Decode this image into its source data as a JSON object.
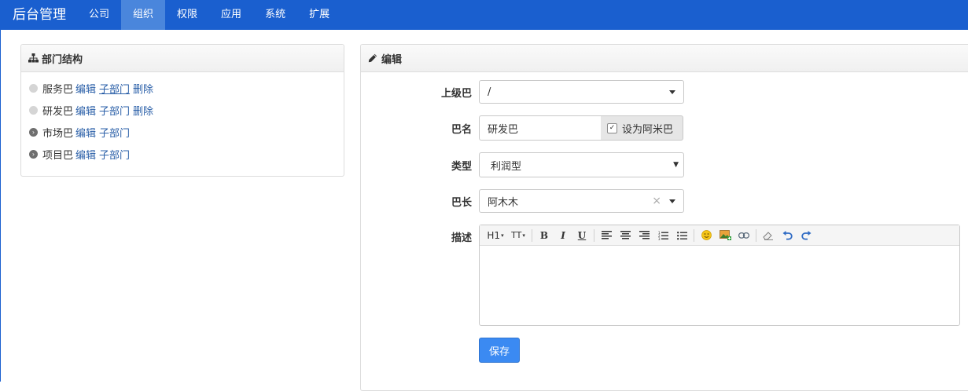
{
  "navbar": {
    "brand": "后台管理",
    "items": [
      {
        "label": "公司",
        "active": false
      },
      {
        "label": "组织",
        "active": true
      },
      {
        "label": "权限",
        "active": false
      },
      {
        "label": "应用",
        "active": false
      },
      {
        "label": "系统",
        "active": false
      },
      {
        "label": "扩展",
        "active": false
      }
    ]
  },
  "tree_panel": {
    "title": "部门结构",
    "icon": "sitemap-icon",
    "rows": [
      {
        "name": "服务巴",
        "type": "leaf",
        "links": [
          "编辑",
          "子部门",
          "删除"
        ]
      },
      {
        "name": "研发巴",
        "type": "leaf",
        "links": [
          "编辑",
          "子部门",
          "删除"
        ]
      },
      {
        "name": "市场巴",
        "type": "branch",
        "links": [
          "编辑",
          "子部门"
        ]
      },
      {
        "name": "项目巴",
        "type": "branch",
        "links": [
          "编辑",
          "子部门"
        ]
      }
    ]
  },
  "edit_panel": {
    "title": "编辑",
    "icon": "pencil-icon",
    "fields": {
      "parent": {
        "label": "上级巴",
        "value": "/"
      },
      "name": {
        "label": "巴名",
        "value": "研发巴",
        "addon": "设为阿米巴",
        "checked": true
      },
      "type": {
        "label": "类型",
        "value": "利润型"
      },
      "leader": {
        "label": "巴长",
        "value": "阿木木"
      },
      "desc": {
        "label": "描述",
        "value": ""
      }
    },
    "toolbar": {
      "h1": "H1",
      "font_size": "TT"
    },
    "save_label": "保存"
  },
  "colors": {
    "navbar": "#1a5fcf",
    "nav_active": "#4a86dc",
    "link": "#2a5fa8",
    "primary_button": "#3b8af2"
  }
}
